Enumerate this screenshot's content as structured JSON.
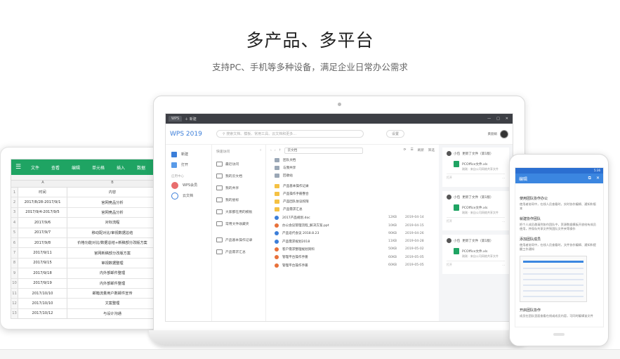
{
  "hero": {
    "title": "多产品、多平台",
    "subtitle": "支持PC、手机等多种设备，满足企业日常办公需求"
  },
  "tablet": {
    "menu": [
      "文件",
      "查看",
      "编辑",
      "单元格",
      "插入",
      "数据"
    ],
    "col_a": "A",
    "col_b": "B",
    "header": {
      "num": "1",
      "a": "时间",
      "b": "内容"
    },
    "rows": [
      {
        "num": "2",
        "a": "2017/8/28-2017/9/1",
        "b": "官网竞品分析"
      },
      {
        "num": "3",
        "a": "2017/9/4-2017/9/5",
        "b": "官网竞品分析"
      },
      {
        "num": "4",
        "a": "2017/9/6",
        "b": "对标流程"
      },
      {
        "num": "5",
        "a": "2017/9/7",
        "b": "移动配对比/审视数据总结"
      },
      {
        "num": "6",
        "a": "2017/9/8",
        "b": "价格功能对比/数据总结+新稿部分改版方案"
      },
      {
        "num": "7",
        "a": "2017/9/11",
        "b": "官网新稿部分改版方案"
      },
      {
        "num": "8",
        "a": "2017/9/15",
        "b": "审视数据整理"
      },
      {
        "num": "9",
        "a": "2017/9/18",
        "b": "内外部邮件整理"
      },
      {
        "num": "10",
        "a": "2017/9/19",
        "b": "内外部邮件整理"
      },
      {
        "num": "11",
        "a": "2017/10/10",
        "b": "邮箱流量用户数邮件宣传"
      },
      {
        "num": "12",
        "a": "2017/10/10",
        "b": "文案整理"
      },
      {
        "num": "13",
        "a": "2017/10/12",
        "b": "与设计沟通"
      }
    ]
  },
  "laptop": {
    "tab_label": "WPS",
    "new_tab": "新建",
    "logo": "WPS 2019",
    "search_placeholder": "搜索文档、模板、常用工具、云文档和更多...",
    "settings": "设置",
    "user": "黄丽娟",
    "left_items": [
      "新建",
      "打开"
    ],
    "left_section": "应用中心",
    "left_apps": [
      "WPS会员",
      "云文档"
    ],
    "nav_head": "快速访问",
    "nav_items": [
      "最近访问",
      "我的云文档",
      "我的共享",
      "我的星标",
      "大家都在用的模板",
      "常用文件收藏夹",
      "产品基本操作记录",
      "产品需求汇总"
    ],
    "path": "云文档",
    "actions": [
      "刷新",
      "筛选"
    ],
    "files": [
      {
        "name": "团队文档",
        "type": "folder",
        "size": "",
        "date": ""
      },
      {
        "name": "与我共享",
        "type": "folder",
        "size": "",
        "date": ""
      },
      {
        "name": "回收站",
        "type": "folder",
        "size": "",
        "date": ""
      },
      {
        "name": "产品基本操作记录",
        "type": "yfolder",
        "size": "",
        "date": ""
      },
      {
        "name": "产品操作手册整合",
        "type": "yfolder",
        "size": "",
        "date": ""
      },
      {
        "name": "产品团队协议权限",
        "type": "yfolder",
        "size": "",
        "date": ""
      },
      {
        "name": "产品需求汇总",
        "type": "yfolder",
        "size": "",
        "date": ""
      },
      {
        "name": "2017产品规划.doc",
        "type": "doc",
        "size": "12KB",
        "date": "2019-04-14"
      },
      {
        "name": "办公会议管理流程_解决方案.ppt",
        "type": "ppt",
        "size": "10KB",
        "date": "2019-04-15"
      },
      {
        "name": "产品迭代会议 2018.8.23",
        "type": "doc",
        "size": "90KB",
        "date": "2019-04-26"
      },
      {
        "name": "产品需求规划2018",
        "type": "doc",
        "size": "11KB",
        "date": "2019-04-28"
      },
      {
        "name": "客户需求整理规划资料",
        "type": "ppt",
        "size": "50KB",
        "date": "2019-05-02"
      },
      {
        "name": "管理平台操作手册",
        "type": "ppt",
        "size": "60KB",
        "date": "2019-05-05"
      },
      {
        "name": "管理平台操作手册",
        "type": "ppt",
        "size": "60KB",
        "date": "2019-05-05"
      }
    ],
    "cards": [
      {
        "who": "小包",
        "action": "更新了文件（第1版）",
        "file": "PCOffice文件.xls",
        "meta": "刚刚 · 来自公司网络共享文件",
        "open": "打开",
        "more": "..."
      },
      {
        "who": "小包",
        "action": "更新了文件（第1版）",
        "file": "PCOffice文件.xls",
        "meta": "刚刚 · 来自公司网络共享文件",
        "open": "打开",
        "more": "..."
      },
      {
        "who": "小包",
        "action": "更新了文件（第1版）",
        "file": "PCOffice文件.xls",
        "meta": "刚刚 · 来自公司网络共享文件",
        "open": "打开",
        "more": "..."
      }
    ]
  },
  "phone": {
    "time": "5:36",
    "title": "编辑",
    "sections": [
      {
        "h": "使用团队协作办公",
        "p": "使用者协同中，在线人员查看时，实时协作编辑、通知和版本"
      },
      {
        "h": "就建协作团队",
        "p": "把个人成员邀请到协作团队中，资源数据模板开放给有成员使用，并保存共享文件到团队文件夹等操作"
      },
      {
        "h": "添加团队成员",
        "p": "使用者协同中，在线人员查看时，文件协作编辑、通知和提醒工作通知"
      },
      {
        "h": "开启团队协作",
        "p": "成员在团队里面查看在线或成员内容，可同时编辑该文件"
      }
    ]
  },
  "colors": {
    "excel_green": "#1fa463",
    "wps_blue": "#3b7ed9",
    "phone_blue": "#3b86e0",
    "folder_yellow": "#f5c143",
    "doc_blue": "#3b7ed9",
    "ppt_orange": "#e8713a"
  }
}
